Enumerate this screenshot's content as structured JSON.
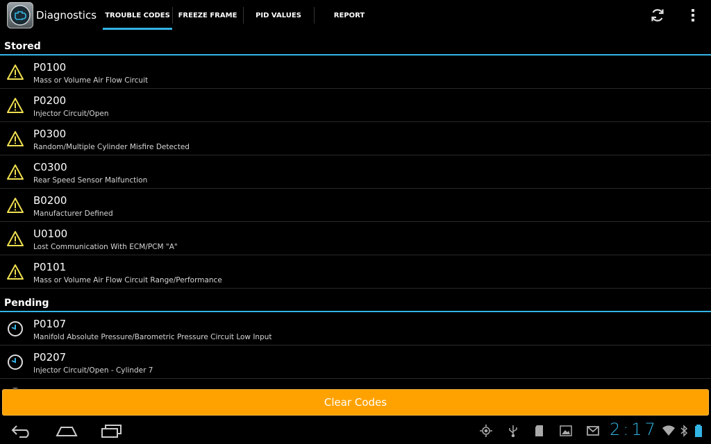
{
  "app": {
    "title": "Diagnostics",
    "icon": "engine-check-icon"
  },
  "tabs": [
    {
      "label": "TROUBLE CODES",
      "selected": true
    },
    {
      "label": "FREEZE FRAME",
      "selected": false
    },
    {
      "label": "PID VALUES",
      "selected": false
    },
    {
      "label": "REPORT",
      "selected": false
    }
  ],
  "actions": {
    "refresh_icon": "refresh-icon",
    "overflow_icon": "overflow-menu-icon"
  },
  "sections": {
    "stored": {
      "header": "Stored",
      "items": [
        {
          "code": "P0100",
          "description": "Mass or Volume Air Flow Circuit"
        },
        {
          "code": "P0200",
          "description": "Injector Circuit/Open"
        },
        {
          "code": "P0300",
          "description": "Random/Multiple Cylinder Misfire Detected"
        },
        {
          "code": "C0300",
          "description": "Rear Speed Sensor Malfunction"
        },
        {
          "code": "B0200",
          "description": "Manufacturer Defined"
        },
        {
          "code": "U0100",
          "description": "Lost Communication With ECM/PCM \"A\""
        },
        {
          "code": "P0101",
          "description": "Mass or Volume Air Flow Circuit Range/Performance"
        }
      ]
    },
    "pending": {
      "header": "Pending",
      "items": [
        {
          "code": "P0107",
          "description": "Manifold Absolute Pressure/Barometric Pressure Circuit Low Input"
        },
        {
          "code": "P0207",
          "description": "Injector Circuit/Open - Cylinder 7"
        },
        {
          "code": "",
          "description": ""
        }
      ]
    }
  },
  "clear_button": {
    "label": "Clear Codes"
  },
  "status_bar": {
    "time": "2:17"
  },
  "colors": {
    "accent": "#33b5e5",
    "button": "#ffa200",
    "warning": "#f0e050"
  }
}
